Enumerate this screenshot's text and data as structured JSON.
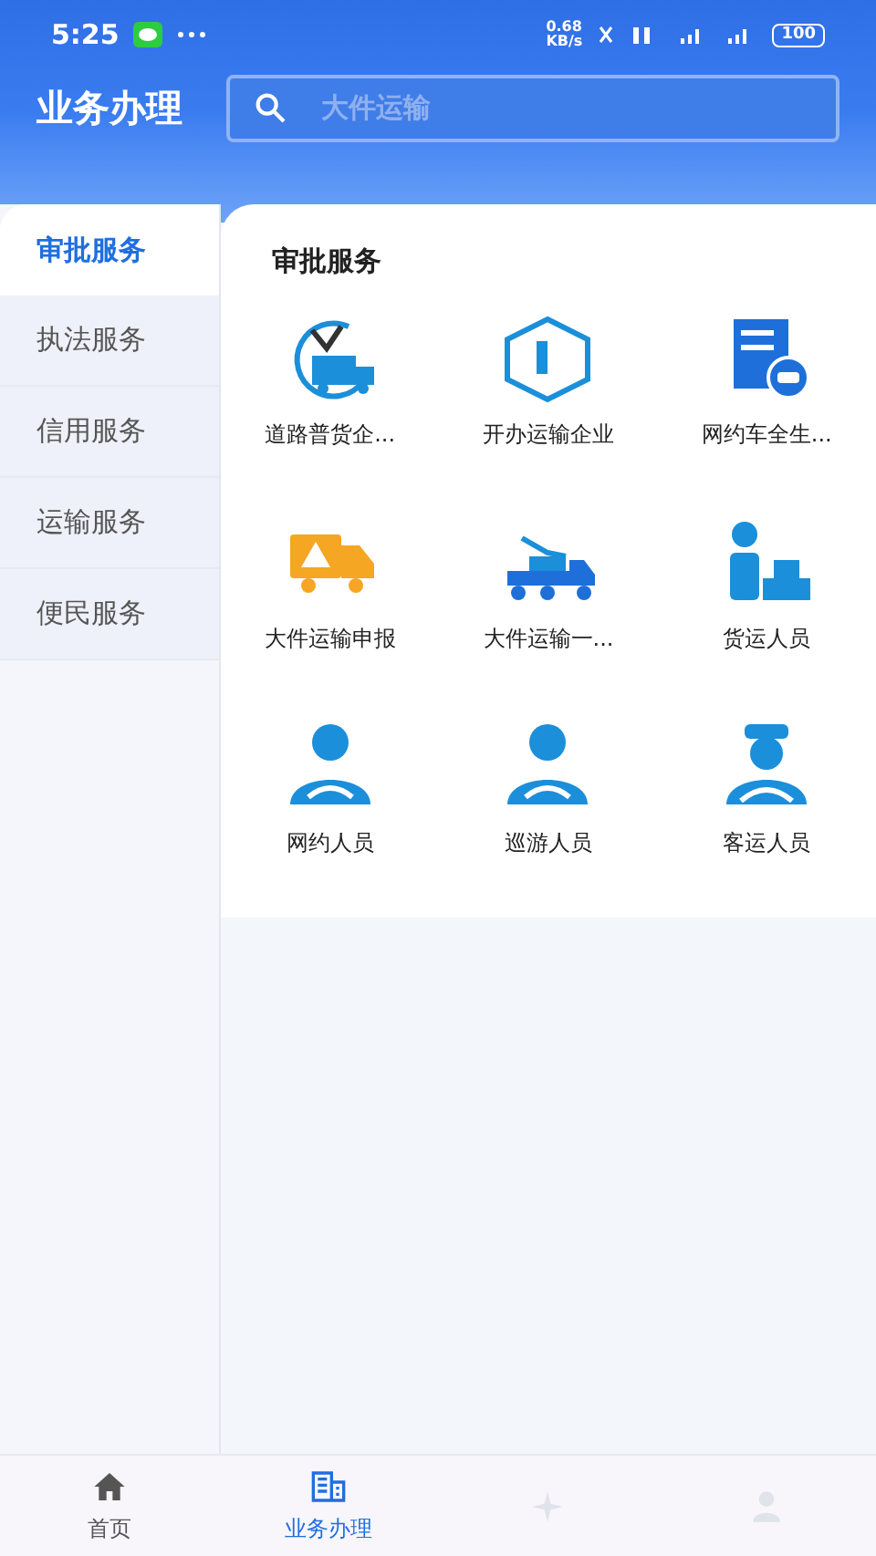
{
  "status_bar": {
    "time": "5:25",
    "network_speed": "0.68 KB/s",
    "battery": "100"
  },
  "header": {
    "title": "业务办理",
    "search": {
      "placeholder": "大件运输"
    }
  },
  "sidebar": {
    "items": [
      {
        "label": "审批服务",
        "selected": true
      },
      {
        "label": "执法服务",
        "selected": false
      },
      {
        "label": "信用服务",
        "selected": false
      },
      {
        "label": "运输服务",
        "selected": false
      },
      {
        "label": "便民服务",
        "selected": false
      }
    ]
  },
  "content": {
    "title": "审批服务",
    "services": [
      {
        "label": "道路普货企..."
      },
      {
        "label": "开办运输企业"
      },
      {
        "label": "网约车全生..."
      },
      {
        "label": "大件运输申报"
      },
      {
        "label": "大件运输一..."
      },
      {
        "label": "货运人员"
      },
      {
        "label": "网约人员"
      },
      {
        "label": "巡游人员"
      },
      {
        "label": "客运人员"
      }
    ]
  },
  "bottom_nav": [
    {
      "label": "首页",
      "selected": false
    },
    {
      "label": "业务办理",
      "selected": true
    },
    {
      "selected": false
    },
    {
      "selected": false
    }
  ]
}
